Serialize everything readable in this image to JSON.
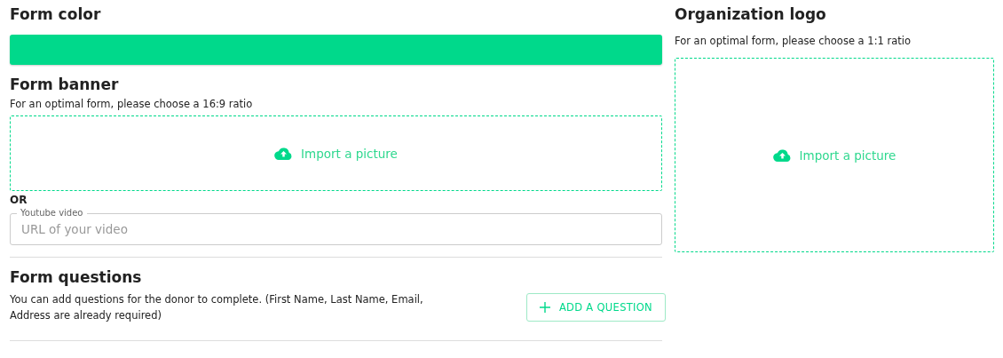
{
  "form_color": {
    "title": "Form color",
    "color": "#00d98b"
  },
  "form_banner": {
    "title": "Form banner",
    "hint": "For an optimal form, please choose a 16:9 ratio",
    "upload": "Import a picture",
    "separator": "OR",
    "video": {
      "label": "Youtube video",
      "placeholder": "URL of your video"
    }
  },
  "form_questions": {
    "title": "Form questions",
    "description": "You can add questions for the donor to complete. (First Name, Last Name, Email, Address are already required)",
    "button": "ADD A QUESTION"
  },
  "organization_logo": {
    "title": "Organization logo",
    "hint": "For an optimal form, please choose a 1:1 ratio",
    "upload": "Import a picture"
  }
}
